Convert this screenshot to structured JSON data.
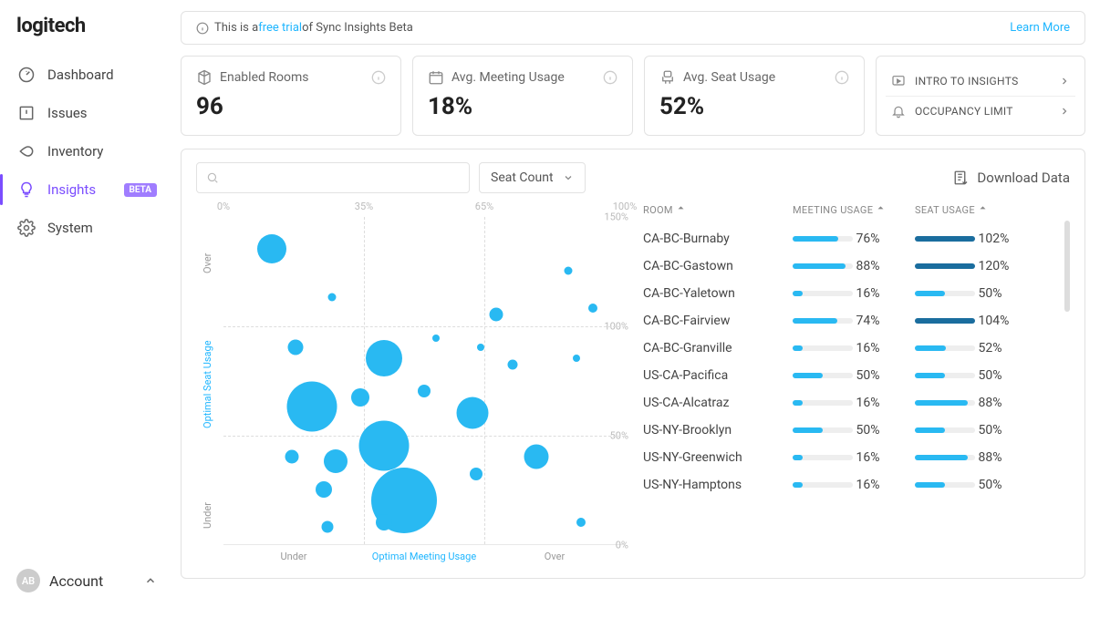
{
  "brand": "logitech",
  "sidebar": {
    "items": [
      {
        "label": "Dashboard",
        "icon": "dashboard"
      },
      {
        "label": "Issues",
        "icon": "issues"
      },
      {
        "label": "Inventory",
        "icon": "inventory"
      },
      {
        "label": "Insights",
        "icon": "insights",
        "badge": "BETA",
        "active": true
      },
      {
        "label": "System",
        "icon": "system"
      }
    ],
    "account": {
      "avatar": "AB",
      "label": "Account"
    }
  },
  "banner": {
    "prefix": "This is a ",
    "link": "free trial",
    "suffix": " of Sync Insights Beta",
    "learn": "Learn More"
  },
  "cards": [
    {
      "icon": "rooms",
      "label": "Enabled Rooms",
      "value": "96"
    },
    {
      "icon": "meeting",
      "label": "Avg. Meeting Usage",
      "value": "18%"
    },
    {
      "icon": "seat",
      "label": "Avg. Seat Usage",
      "value": "52%"
    }
  ],
  "side_links": [
    {
      "icon": "play",
      "label": "INTRO TO INSIGHTS"
    },
    {
      "icon": "bell",
      "label": "OCCUPANCY LIMIT"
    }
  ],
  "panel": {
    "dropdown": "Seat Count",
    "download": "Download Data",
    "search_placeholder": ""
  },
  "table": {
    "headers": {
      "room": "ROOM",
      "mu": "MEETING USAGE",
      "su": "SEAT USAGE"
    },
    "rows": [
      {
        "room": "CA-BC-Burnaby",
        "mu": 76,
        "su": 102
      },
      {
        "room": "CA-BC-Gastown",
        "mu": 88,
        "su": 120
      },
      {
        "room": "CA-BC-Yaletown",
        "mu": 16,
        "su": 50
      },
      {
        "room": "CA-BC-Fairview",
        "mu": 74,
        "su": 104
      },
      {
        "room": "CA-BC-Granville",
        "mu": 16,
        "su": 52
      },
      {
        "room": "US-CA-Pacifica",
        "mu": 50,
        "su": 50
      },
      {
        "room": "US-CA-Alcatraz",
        "mu": 16,
        "su": 88
      },
      {
        "room": "US-NY-Brooklyn",
        "mu": 50,
        "su": 50
      },
      {
        "room": "US-NY-Greenwich",
        "mu": 16,
        "su": 88
      },
      {
        "room": "US-NY-Hamptons",
        "mu": 16,
        "su": 50
      }
    ]
  },
  "chart_data": {
    "type": "scatter",
    "xlabel_segments": [
      "Under",
      "Optimal Meeting Usage",
      "Over"
    ],
    "ylabel_segments": [
      "Under",
      "Optimal Seat Usage",
      "Over"
    ],
    "x_ticks": [
      "0%",
      "35%",
      "65%",
      "100%"
    ],
    "y_ticks": [
      "0%",
      "50%",
      "100%",
      "150%"
    ],
    "xlim": [
      0,
      100
    ],
    "ylim": [
      0,
      150
    ],
    "size_encoding": "Seat Count",
    "points": [
      {
        "x": 12,
        "y": 135,
        "size": 32
      },
      {
        "x": 27,
        "y": 113,
        "size": 9
      },
      {
        "x": 68,
        "y": 105,
        "size": 15
      },
      {
        "x": 86,
        "y": 125,
        "size": 9
      },
      {
        "x": 92,
        "y": 108,
        "size": 10
      },
      {
        "x": 18,
        "y": 90,
        "size": 17
      },
      {
        "x": 40,
        "y": 85,
        "size": 40
      },
      {
        "x": 53,
        "y": 94,
        "size": 8
      },
      {
        "x": 64,
        "y": 90,
        "size": 8
      },
      {
        "x": 72,
        "y": 82,
        "size": 11
      },
      {
        "x": 88,
        "y": 85,
        "size": 8
      },
      {
        "x": 22,
        "y": 63,
        "size": 55
      },
      {
        "x": 34,
        "y": 67,
        "size": 20
      },
      {
        "x": 50,
        "y": 70,
        "size": 14
      },
      {
        "x": 62,
        "y": 60,
        "size": 35
      },
      {
        "x": 17,
        "y": 40,
        "size": 15
      },
      {
        "x": 28,
        "y": 38,
        "size": 26
      },
      {
        "x": 40,
        "y": 45,
        "size": 55
      },
      {
        "x": 78,
        "y": 40,
        "size": 27
      },
      {
        "x": 25,
        "y": 25,
        "size": 18
      },
      {
        "x": 45,
        "y": 20,
        "size": 72
      },
      {
        "x": 63,
        "y": 32,
        "size": 14
      },
      {
        "x": 26,
        "y": 8,
        "size": 13
      },
      {
        "x": 40,
        "y": 10,
        "size": 18
      },
      {
        "x": 89,
        "y": 10,
        "size": 10
      }
    ]
  }
}
